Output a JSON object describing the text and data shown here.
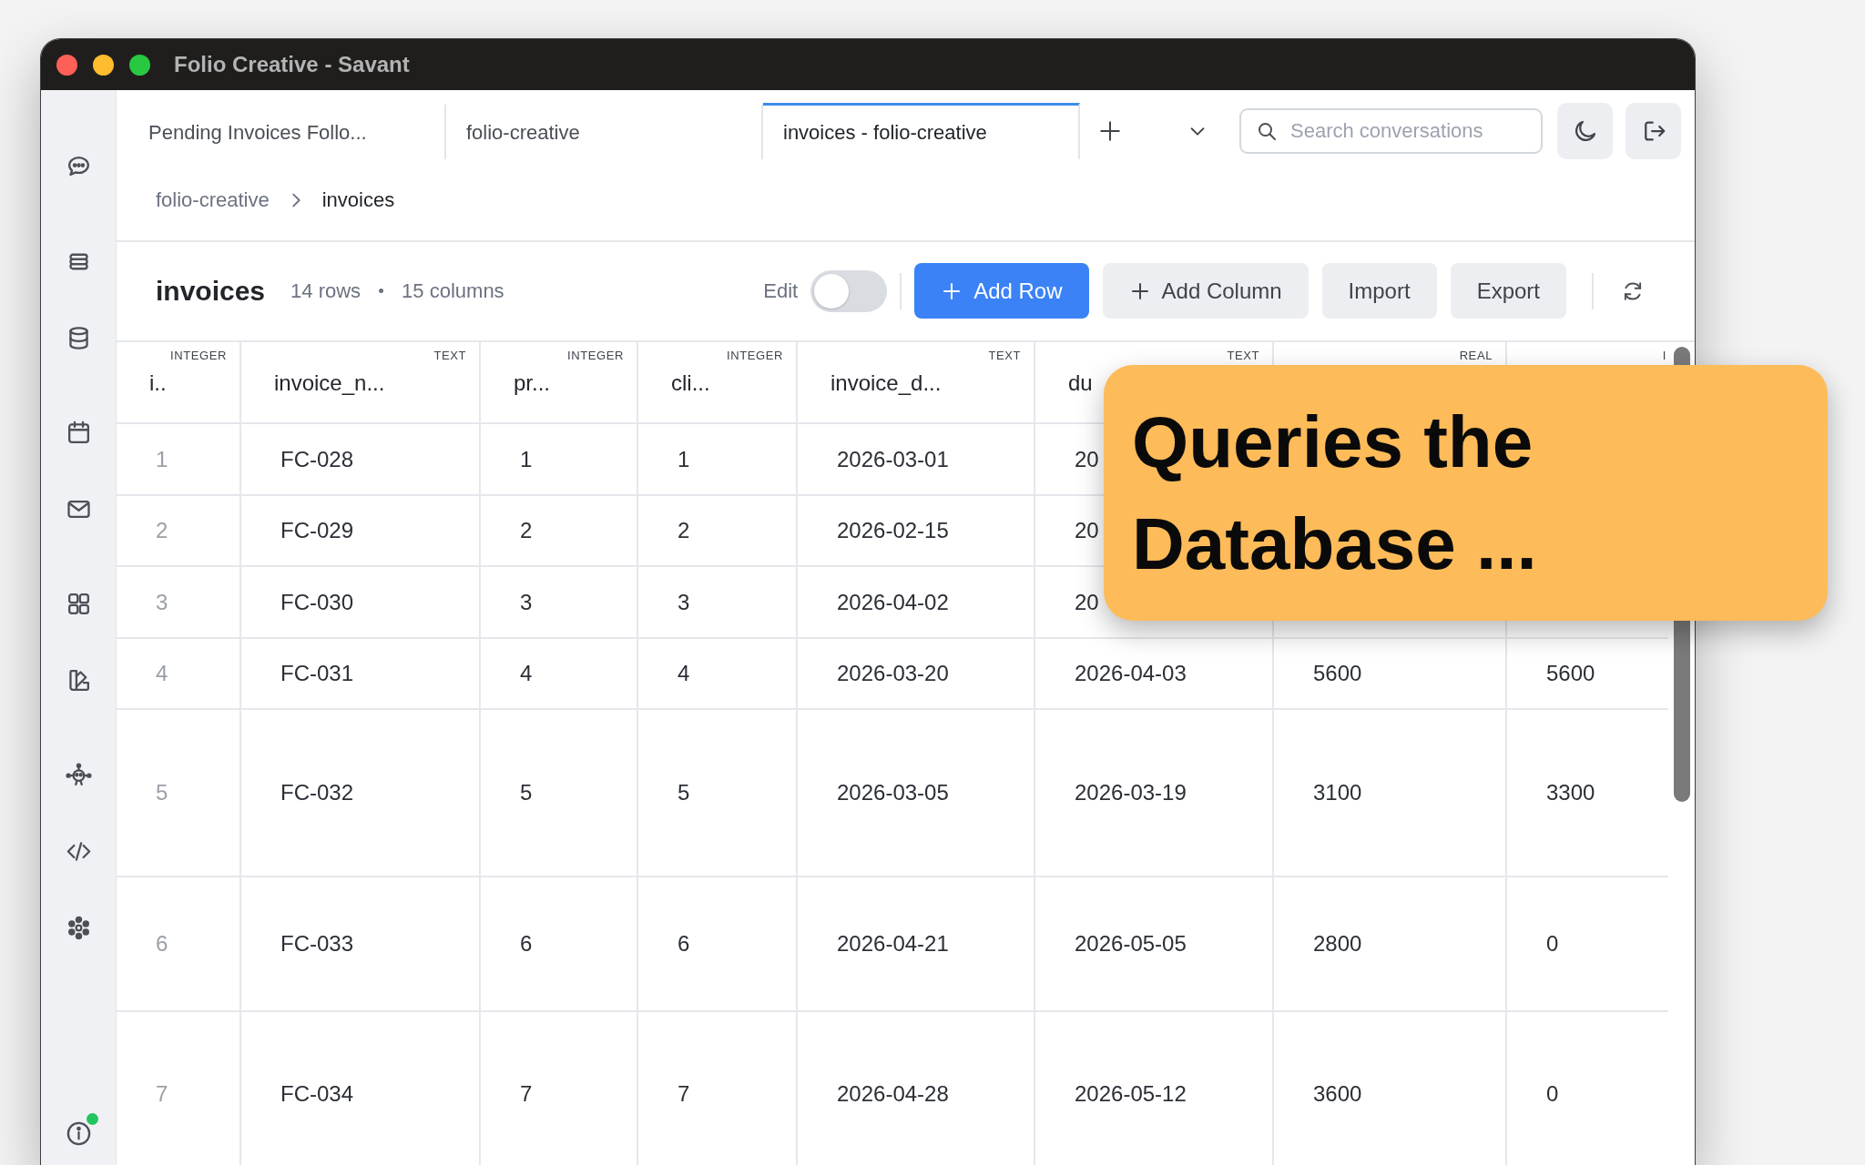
{
  "window": {
    "title": "Folio Creative - Savant"
  },
  "sidebar": {
    "items": [
      {
        "selected": false
      },
      {
        "selected": false
      },
      {
        "selected": false
      },
      {
        "selected": false
      },
      {
        "selected": false
      },
      {
        "selected": false
      },
      {
        "selected": false
      },
      {
        "selected": false
      },
      {
        "selected": false
      },
      {
        "selected": false
      }
    ],
    "info": {
      "badge": true
    }
  },
  "tabs": [
    {
      "label": "Pending Invoices Follo...",
      "selected": false
    },
    {
      "label": "folio-creative",
      "selected": false
    },
    {
      "label": "invoices - folio-creative",
      "selected": true
    }
  ],
  "search": {
    "placeholder": "Search conversations"
  },
  "breadcrumb": [
    {
      "label": "folio-creative",
      "current": false
    },
    {
      "label": "invoices",
      "current": true
    }
  ],
  "toolbar": {
    "title": "invoices",
    "row_count": "14 rows",
    "column_count": "15 columns",
    "edit": {
      "label": "Edit",
      "on": false
    },
    "buttons": [
      {
        "label": "Add Row",
        "kind": "primary",
        "has_icon": true
      },
      {
        "label": "Add Column",
        "kind": "secondary",
        "has_icon": true
      },
      {
        "label": "Import",
        "kind": "secondary",
        "has_icon": false
      },
      {
        "label": "Export",
        "kind": "secondary",
        "has_icon": false
      }
    ]
  },
  "table": {
    "columns": [
      {
        "type": "INTEGER",
        "name": "i.."
      },
      {
        "type": "TEXT",
        "name": "invoice_n..."
      },
      {
        "type": "INTEGER",
        "name": "pr..."
      },
      {
        "type": "INTEGER",
        "name": "cli..."
      },
      {
        "type": "TEXT",
        "name": "invoice_d..."
      },
      {
        "type": "TEXT",
        "name": "du"
      },
      {
        "type": "REAL"
      },
      {
        "type": "I"
      }
    ],
    "rows": [
      {
        "cells": [
          "1",
          "FC-028",
          "1",
          "1",
          "2026-03-01",
          "20"
        ]
      },
      {
        "cells": [
          "2",
          "FC-029",
          "2",
          "2",
          "2026-02-15",
          "20"
        ]
      },
      {
        "cells": [
          "3",
          "FC-030",
          "3",
          "3",
          "2026-04-02",
          "20"
        ]
      },
      {
        "cells": [
          "4",
          "FC-031",
          "4",
          "4",
          "2026-03-20",
          "2026-04-03",
          "5600",
          "5600"
        ]
      },
      {
        "cells": [
          "5",
          "FC-032",
          "5",
          "5",
          "2026-03-05",
          "2026-03-19",
          "3100",
          "3300"
        ]
      },
      {
        "cells": [
          "6",
          "FC-033",
          "6",
          "6",
          "2026-04-21",
          "2026-05-05",
          "2800",
          "0"
        ]
      },
      {
        "cells": [
          "7",
          "FC-034",
          "7",
          "7",
          "2026-04-28",
          "2026-05-12",
          "3600",
          "0"
        ]
      }
    ]
  },
  "callout": {
    "text": "Queries the Database ..."
  }
}
